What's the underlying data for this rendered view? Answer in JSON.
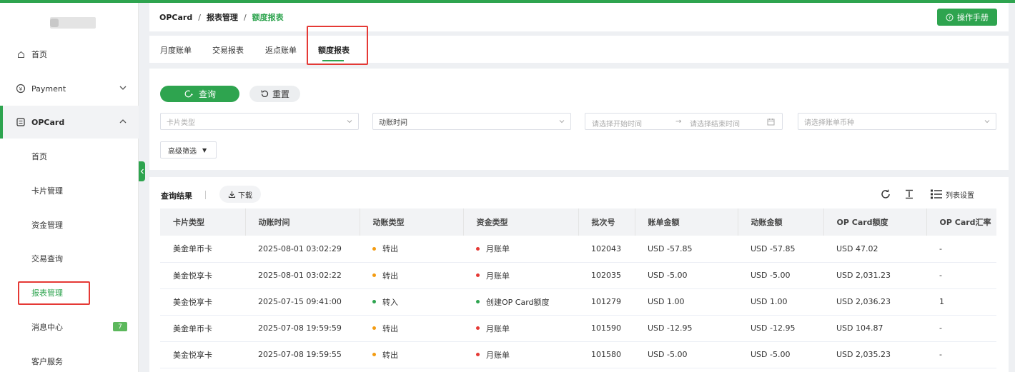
{
  "colors": {
    "accent": "#2ea44f",
    "dot_out": "#f39c12",
    "dot_in": "#2ea44f",
    "dot_bill": "#e53935",
    "highlight_box": "#e53935"
  },
  "sidebar": {
    "home_label": "首页",
    "payment_label": "Payment",
    "opcard_label": "OPCard",
    "sub_items": [
      {
        "label": "首页"
      },
      {
        "label": "卡片管理"
      },
      {
        "label": "资金管理"
      },
      {
        "label": "交易查询"
      },
      {
        "label": "报表管理"
      },
      {
        "label": "消息中心",
        "badge": "7"
      },
      {
        "label": "客户服务"
      }
    ]
  },
  "header": {
    "breadcrumb": [
      "OPCard",
      "报表管理",
      "额度报表"
    ],
    "separator": "/",
    "manual_button": "操作手册"
  },
  "tabs": [
    "月度账单",
    "交易报表",
    "返点账单",
    "额度报表"
  ],
  "filter": {
    "query_button": "查询",
    "reset_button": "重置",
    "card_type_placeholder": "卡片类型",
    "time_field_value": "动账时间",
    "start_placeholder": "请选择开始时间",
    "range_arrow": "→",
    "end_placeholder": "请选择结束时间",
    "currency_placeholder": "请选择账单币种",
    "advanced_label": "高级筛选"
  },
  "results": {
    "title": "查询结果",
    "download_button": "下载",
    "column_settings": "列表设置",
    "columns": [
      "卡片类型",
      "动账时间",
      "动账类型",
      "资金类型",
      "批次号",
      "账单金额",
      "动账金额",
      "OP Card额度",
      "OP Card汇率"
    ],
    "rows": [
      {
        "card_type": "美金单币卡",
        "time": "2025-08-01 03:02:29",
        "move_type": "转出",
        "move_color": "dot_out",
        "fund_type": "月账单",
        "batch": "102043",
        "bill_amount": "USD -57.85",
        "move_amount": "USD -57.85",
        "limit": "USD 47.02",
        "rate": "-"
      },
      {
        "card_type": "美金悦享卡",
        "time": "2025-08-01 03:02:22",
        "move_type": "转出",
        "move_color": "dot_out",
        "fund_type": "月账单",
        "batch": "102035",
        "bill_amount": "USD -5.00",
        "move_amount": "USD -5.00",
        "limit": "USD 2,031.23",
        "rate": "-"
      },
      {
        "card_type": "美金悦享卡",
        "time": "2025-07-15 09:41:00",
        "move_type": "转入",
        "move_color": "dot_in",
        "fund_type": "创建OP Card额度",
        "fund_color": "dot_in",
        "batch": "101279",
        "bill_amount": "USD 1.00",
        "move_amount": "USD 1.00",
        "limit": "USD 2,036.23",
        "rate": "1"
      },
      {
        "card_type": "美金单币卡",
        "time": "2025-07-08 19:59:59",
        "move_type": "转出",
        "move_color": "dot_out",
        "fund_type": "月账单",
        "batch": "101590",
        "bill_amount": "USD -12.95",
        "move_amount": "USD -12.95",
        "limit": "USD 104.87",
        "rate": "-"
      },
      {
        "card_type": "美金悦享卡",
        "time": "2025-07-08 19:59:55",
        "move_type": "转出",
        "move_color": "dot_out",
        "fund_type": "月账单",
        "batch": "101580",
        "bill_amount": "USD -5.00",
        "move_amount": "USD -5.00",
        "limit": "USD 2,035.23",
        "rate": "-"
      }
    ]
  }
}
